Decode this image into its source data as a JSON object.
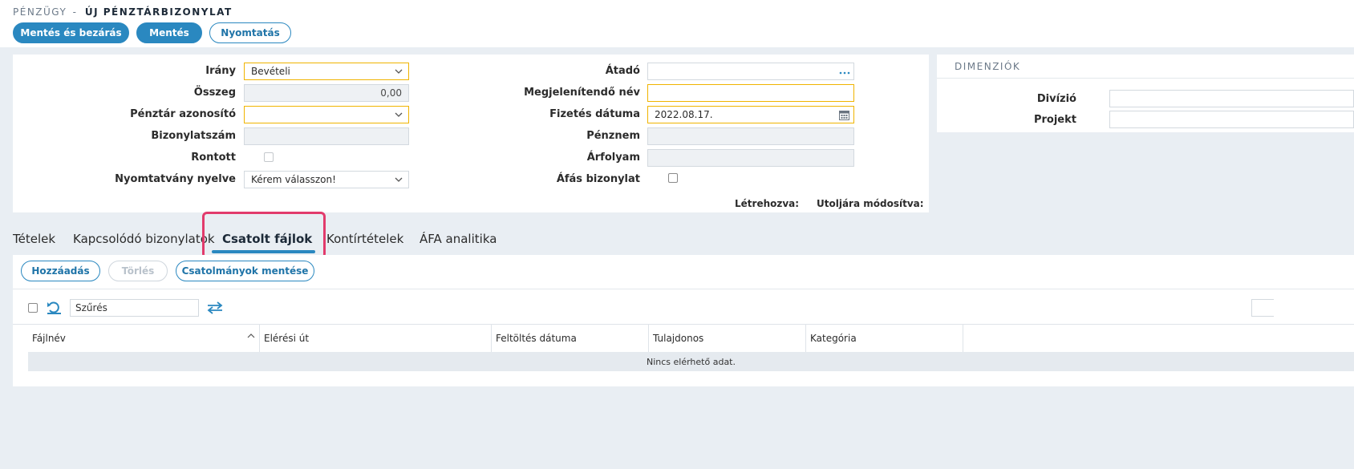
{
  "header": {
    "section": "Pénzügy",
    "separator": "-",
    "title": "Új pénztárbizonylat"
  },
  "toolbar": {
    "save_close_label": "Mentés és bezárás",
    "save_label": "Mentés",
    "print_label": "Nyomtatás"
  },
  "form": {
    "direction_label": "Irány",
    "direction_value": "Bevételi",
    "amount_label": "Összeg",
    "amount_value": "0,00",
    "cashbox_label": "Pénztár azonosító",
    "cashbox_value": "",
    "docnumber_label": "Bizonylatszám",
    "docnumber_value": "",
    "voided_label": "Rontott",
    "print_language_label": "Nyomtatvány nyelve",
    "print_language_value": "Kérem válasszon!",
    "handover_label": "Átadó",
    "handover_value": "",
    "display_name_label": "Megjelenítendő név",
    "display_name_value": "",
    "payment_date_label": "Fizetés dátuma",
    "payment_date_value": "2022.08.17.",
    "currency_label": "Pénznem",
    "currency_value": "",
    "rate_label": "Árfolyam",
    "rate_value": "",
    "vat_doc_label": "Áfás bizonylat",
    "created_label": "Létrehozva:",
    "modified_label": "Utoljára módosítva:"
  },
  "dimensions": {
    "header": "Dimenziók",
    "division_label": "Divízió",
    "division_value": "",
    "project_label": "Projekt",
    "project_value": ""
  },
  "tabs": [
    {
      "label": "Tételek"
    },
    {
      "label": "Kapcsolódó bizonylatok"
    },
    {
      "label": "Csatolt fájlok"
    },
    {
      "label": "Kontírtételek"
    },
    {
      "label": "ÁFA analitika"
    }
  ],
  "attachments": {
    "add_label": "Hozzáadás",
    "delete_label": "Törlés",
    "save_label": "Csatolmányok mentése",
    "filter_placeholder": "Szűrés",
    "columns": [
      "Fájlnév",
      "Elérési út",
      "Feltöltés dátuma",
      "Tulajdonos",
      "Kategória"
    ],
    "empty_text": "Nincs elérhető adat."
  },
  "colors": {
    "accent": "#2a88c0",
    "highlight": "#e23b6c",
    "required_border": "#f0b400"
  }
}
